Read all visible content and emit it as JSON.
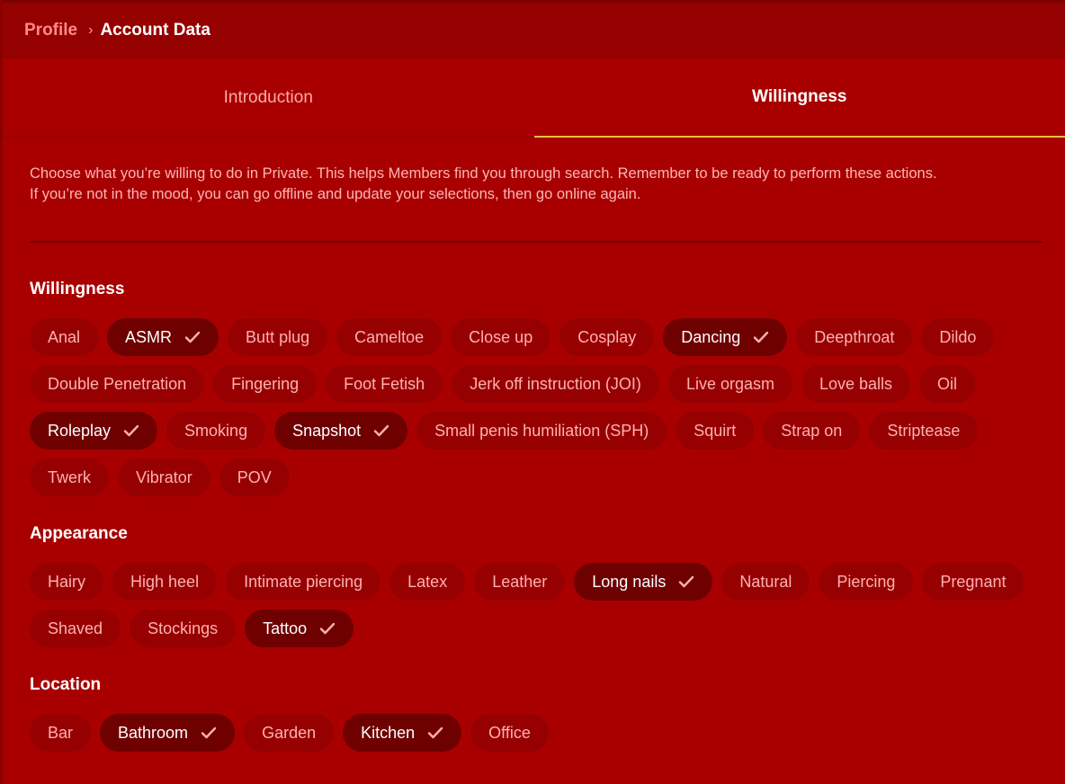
{
  "breadcrumb": {
    "parent": "Profile",
    "separator": "›",
    "current": "Account Data"
  },
  "tabs": [
    {
      "label": "Introduction",
      "active": false
    },
    {
      "label": "Willingness",
      "active": true
    }
  ],
  "description": {
    "line1": "Choose what you’re willing to do in Private. This helps Members find you through search. Remember to be ready to perform these actions.",
    "line2": "If you’re not in the mood, you can go offline and update your selections, then go online again."
  },
  "colors": {
    "background": "#a80000",
    "chip": "#960000",
    "chip_selected": "#6e0000",
    "tab_underline": "#f0c040"
  },
  "sections": {
    "willingness": {
      "title": "Willingness",
      "chips": [
        {
          "label": "Anal",
          "selected": false
        },
        {
          "label": "ASMR",
          "selected": true
        },
        {
          "label": "Butt plug",
          "selected": false
        },
        {
          "label": "Cameltoe",
          "selected": false
        },
        {
          "label": "Close up",
          "selected": false
        },
        {
          "label": "Cosplay",
          "selected": false
        },
        {
          "label": "Dancing",
          "selected": true
        },
        {
          "label": "Deepthroat",
          "selected": false
        },
        {
          "label": "Dildo",
          "selected": false
        },
        {
          "label": "Double Penetration",
          "selected": false
        },
        {
          "label": "Fingering",
          "selected": false
        },
        {
          "label": "Foot Fetish",
          "selected": false
        },
        {
          "label": "Jerk off instruction (JOI)",
          "selected": false
        },
        {
          "label": "Live orgasm",
          "selected": false
        },
        {
          "label": "Love balls",
          "selected": false
        },
        {
          "label": "Oil",
          "selected": false
        },
        {
          "label": "Roleplay",
          "selected": true
        },
        {
          "label": "Smoking",
          "selected": false
        },
        {
          "label": "Snapshot",
          "selected": true
        },
        {
          "label": "Small penis humiliation (SPH)",
          "selected": false
        },
        {
          "label": "Squirt",
          "selected": false
        },
        {
          "label": "Strap on",
          "selected": false
        },
        {
          "label": "Striptease",
          "selected": false
        },
        {
          "label": "Twerk",
          "selected": false
        },
        {
          "label": "Vibrator",
          "selected": false
        },
        {
          "label": "POV",
          "selected": false
        }
      ]
    },
    "appearance": {
      "title": "Appearance",
      "chips": [
        {
          "label": "Hairy",
          "selected": false
        },
        {
          "label": "High heel",
          "selected": false
        },
        {
          "label": "Intimate piercing",
          "selected": false
        },
        {
          "label": "Latex",
          "selected": false
        },
        {
          "label": "Leather",
          "selected": false
        },
        {
          "label": "Long nails",
          "selected": true
        },
        {
          "label": "Natural",
          "selected": false
        },
        {
          "label": "Piercing",
          "selected": false
        },
        {
          "label": "Pregnant",
          "selected": false
        },
        {
          "label": "Shaved",
          "selected": false
        },
        {
          "label": "Stockings",
          "selected": false
        },
        {
          "label": "Tattoo",
          "selected": true
        }
      ]
    },
    "location": {
      "title": "Location",
      "chips": [
        {
          "label": "Bar",
          "selected": false
        },
        {
          "label": "Bathroom",
          "selected": true
        },
        {
          "label": "Garden",
          "selected": false
        },
        {
          "label": "Kitchen",
          "selected": true
        },
        {
          "label": "Office",
          "selected": false
        }
      ]
    }
  }
}
